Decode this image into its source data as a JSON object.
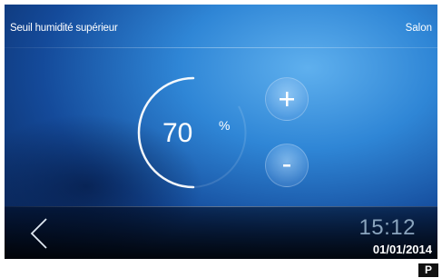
{
  "header": {
    "title": "Seuil humidité supérieur",
    "room": "Salon"
  },
  "setpoint": {
    "value": "70",
    "unit": "%"
  },
  "controls": {
    "increase_icon": "plus-icon",
    "decrease_icon": "minus-icon"
  },
  "footer": {
    "back_icon": "chevron-left-icon",
    "time": "15:12",
    "date": "01/01/2014"
  },
  "badge": {
    "label": "P"
  },
  "colors": {
    "background_accent": "#2f86d6",
    "text": "#ffffff",
    "time_text": "#8aa4bd"
  }
}
